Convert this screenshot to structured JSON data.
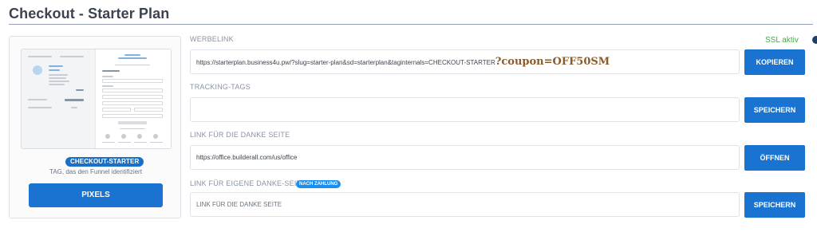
{
  "page": {
    "title": "Checkout - Starter Plan"
  },
  "preview": {
    "tag_badge": "CHECKOUT-STARTER",
    "tag_description": "TAG, das den Funnel identifiziert",
    "pixels_label": "PIXELS"
  },
  "ssl_status": "SSL aktiv",
  "fields": {
    "werbelink": {
      "label": "WERBELINK",
      "url": "https://starterplan.business4u.pw/?slug=starter-plan&sd=starterplan&taginternals=CHECKOUT-STARTER",
      "coupon": "?coupon=OFF50SM",
      "button": "KOPIEREN"
    },
    "tracking": {
      "label": "TRACKING-TAGS",
      "value": "",
      "button": "SPEICHERN"
    },
    "danke": {
      "label": "LINK FÜR DIE DANKE SEITE",
      "value": "https://office.builderall.com/us/office",
      "button": "ÖFFNEN"
    },
    "eigene_danke": {
      "label": "LINK FÜR EIGENE DANKE-SEITE",
      "badge": "NACH ZAHLUNG",
      "placeholder": "LINK FÜR DIE DANKE SEITE",
      "button": "SPEICHERN"
    }
  }
}
